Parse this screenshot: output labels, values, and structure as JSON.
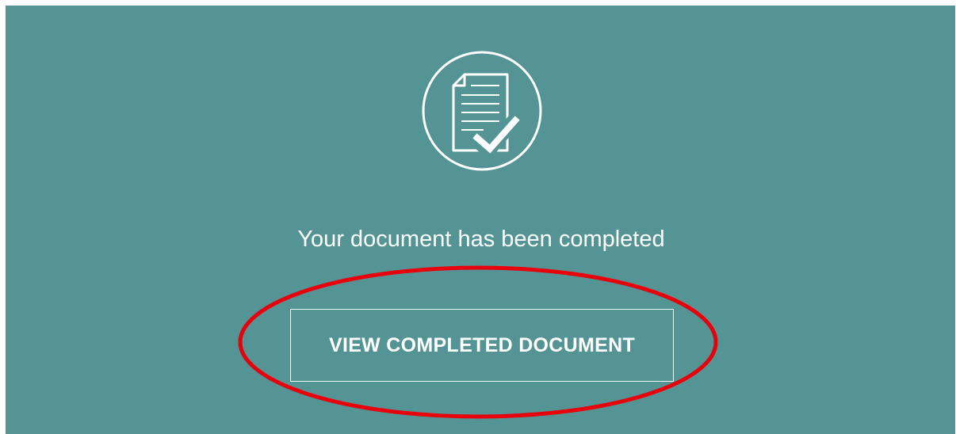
{
  "completion": {
    "icon": "document-check-icon",
    "message": "Your document has been completed",
    "view_button_label": "VIEW COMPLETED DOCUMENT"
  },
  "colors": {
    "panel_background": "#559494",
    "foreground": "#ffffff",
    "annotation": "#e8000b"
  }
}
